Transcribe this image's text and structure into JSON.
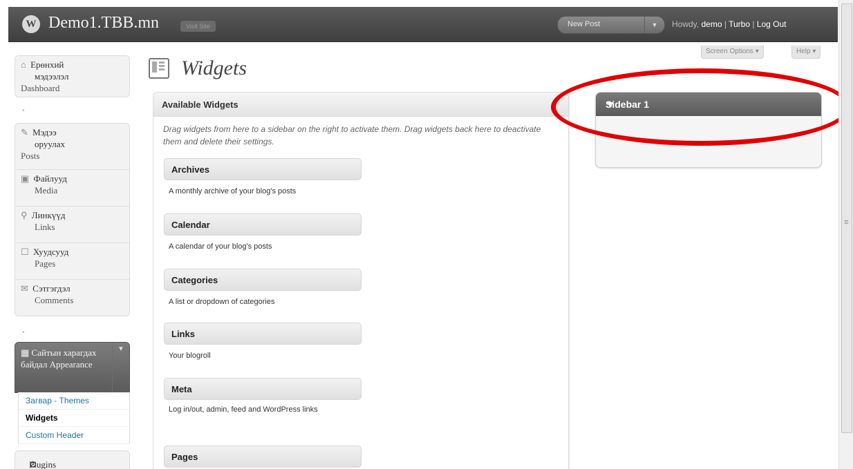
{
  "header": {
    "logo_glyph": "W",
    "site_title": "Demo1.TBB.mn",
    "visit_site": "Visit Site",
    "favorite_action": "New Post",
    "favorite_arrow": "▼",
    "howdy": "Howdy,",
    "username": "demo",
    "sep1": "|",
    "turbo": "Turbo",
    "sep2": "|",
    "logout": "Log Out"
  },
  "screen_options": "Screen Options ▾",
  "help": "Help ▾",
  "menu": {
    "dashboard": {
      "icon": "⌂",
      "label": "Ерөнхий",
      "label2": "мэдээлэл",
      "sub": "Dashboard"
    },
    "posts": {
      "icon": "✎",
      "label": "Мэдээ",
      "label2": "оруулах",
      "sub": "Posts"
    },
    "media": {
      "icon": "▣",
      "label": "Файлууд",
      "sub": "Media"
    },
    "links": {
      "icon": "⚲",
      "label": "Линкүүд",
      "sub": "Links"
    },
    "pages": {
      "icon": "☐",
      "label": "Хуудсууд",
      "sub": "Pages"
    },
    "comments": {
      "icon": "✉",
      "label": "Сэтгэгдэл",
      "sub": "Comments"
    },
    "separator": "•",
    "appearance": {
      "icon": "▦",
      "label": "Сайтын харагдах байдал  Appearance",
      "arrow": "▼"
    },
    "appearance_sub": [
      "Загвар - Themes",
      "Widgets",
      "Custom Header"
    ],
    "plugins": {
      "icon": "⚙",
      "label": "Plugins"
    }
  },
  "page": {
    "title": "Widgets"
  },
  "available": {
    "heading": "Available Widgets",
    "description": "Drag widgets from here to a sidebar on the right to activate them. Drag widgets back here to deactivate them and delete their settings."
  },
  "widgets": [
    {
      "name": "Archives",
      "desc": "A monthly archive of your blog's posts"
    },
    {
      "name": "Calendar",
      "desc": "A calendar of your blog's posts"
    },
    {
      "name": "Categories",
      "desc": "A list or dropdown of categories"
    },
    {
      "name": "Links",
      "desc": "Your blogroll"
    },
    {
      "name": "Meta",
      "desc": "Log in/out, admin, feed and WordPress links"
    },
    {
      "name": "Pages",
      "desc": ""
    }
  ],
  "sidebar": {
    "title": "Sidebar 1",
    "arrow": "▼"
  },
  "annotation_color": "#e00000"
}
